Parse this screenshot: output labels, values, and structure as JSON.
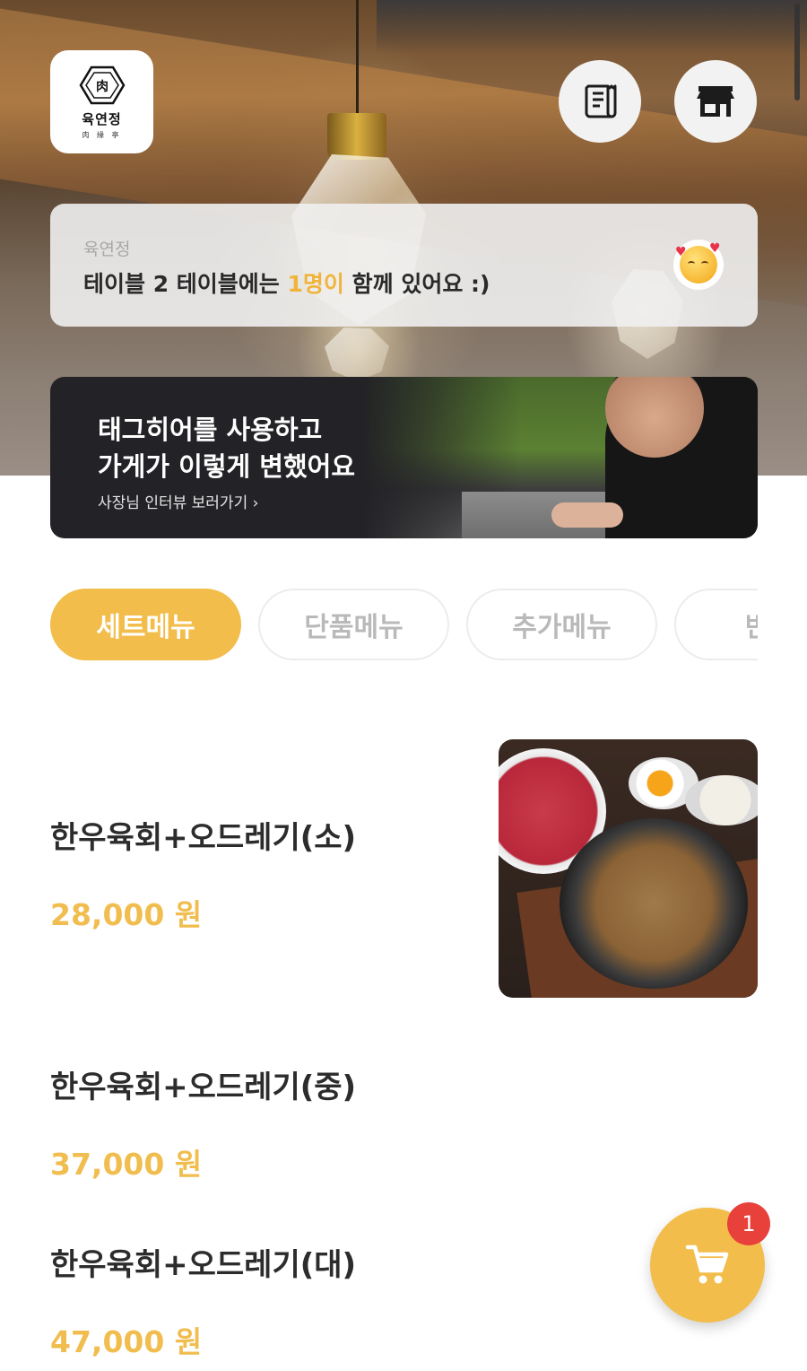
{
  "header": {
    "logo": {
      "name": "육연정",
      "sub": "肉 緣 亭"
    },
    "receipt_icon": "receipt-icon",
    "store_icon": "store-icon"
  },
  "table_card": {
    "store_name": "육연정",
    "msg_prefix": "테이블 2 테이블에는 ",
    "msg_highlight": "1명이",
    "msg_suffix": " 함께 있어요 :)",
    "emoji_icon": "smiling-face-with-hearts-icon"
  },
  "banner": {
    "line1": "태그히어를 사용하고",
    "line2": "가게가 이렇게 변했어요",
    "link": "사장님 인터뷰 보러가기 ›"
  },
  "tabs": [
    {
      "label": "세트메뉴",
      "active": true
    },
    {
      "label": "단품메뉴",
      "active": false
    },
    {
      "label": "추가메뉴",
      "active": false
    },
    {
      "label": "반찬",
      "active": false
    }
  ],
  "menu_items": [
    {
      "name": "한우육회+오드레기(소)",
      "price": "28,000 원"
    },
    {
      "name": "한우육회+오드레기(중)",
      "price": "37,000 원"
    },
    {
      "name": "한우육회+오드레기(대)",
      "price": "47,000 원"
    }
  ],
  "cart": {
    "count": "1",
    "icon": "cart-icon"
  },
  "colors": {
    "accent": "#f2bd4a",
    "price": "#f0bd4e",
    "badge": "#e8403a"
  }
}
